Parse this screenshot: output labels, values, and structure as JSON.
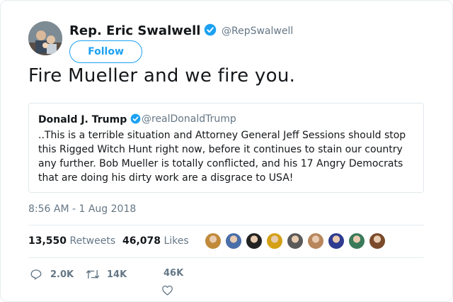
{
  "author": {
    "name": "Rep. Eric Swalwell",
    "handle": "@RepSwalwell",
    "follow_label": "Follow"
  },
  "tweet": {
    "text": "Fire Mueller and we fire you."
  },
  "quoted": {
    "name": "Donald J. Trump",
    "handle": "@realDonaldTrump",
    "text": "..This is a terrible situation and Attorney General Jeff Sessions should stop this Rigged Witch Hunt right now, before it continues to stain our country any further. Bob Mueller is totally conflicted, and his 17 Angry Democrats that are doing his dirty work are a disgrace to USA!"
  },
  "timestamp": "8:56 AM - 1 Aug 2018",
  "stats": {
    "retweets_count": "13,550",
    "retweets_label": "Retweets",
    "likes_count": "46,078",
    "likes_label": "Likes"
  },
  "actions": {
    "reply_count": "2.0K",
    "retweet_count": "14K",
    "like_count": "46K"
  },
  "liker_avatar_colors": [
    "#c08a3a",
    "#4a6ea8",
    "#222222",
    "#d4a017",
    "#5a5a5a",
    "#b8865b",
    "#2f3b8f",
    "#3a7a5a",
    "#7a4a2a"
  ],
  "colors": {
    "accent": "#1da1f2",
    "secondary_text": "#657786"
  }
}
